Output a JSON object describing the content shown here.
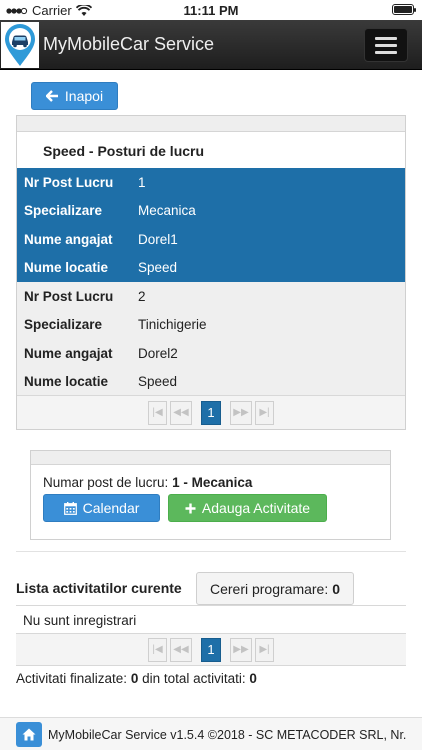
{
  "status_bar": {
    "carrier": "Carrier",
    "time": "11:11 PM"
  },
  "navbar": {
    "title": "MyMobileCar Service"
  },
  "back_button": {
    "label": "Inapoi"
  },
  "posts_panel": {
    "caption": "Speed - Posturi de lucru",
    "labels": {
      "nr": "Nr Post Lucru",
      "spec": "Specializare",
      "angajat": "Nume angajat",
      "locatie": "Nume locatie"
    },
    "records": [
      {
        "nr": "1",
        "spec": "Mecanica",
        "angajat": "Dorel1",
        "locatie": "Speed"
      },
      {
        "nr": "2",
        "spec": "Tinichigerie",
        "angajat": "Dorel2",
        "locatie": "Speed"
      }
    ],
    "current_page": "1"
  },
  "selected_post": {
    "label": "Numar post de lucru:",
    "value": "1 - Mecanica",
    "calendar_label": "Calendar",
    "add_activity_label": "Adauga Activitate"
  },
  "activities": {
    "title": "Lista activitatilor curente",
    "requests_label": "Cereri programare:",
    "requests_count": "0",
    "empty_text": "Nu sunt inregistrari",
    "current_page": "1",
    "finalized_label": "Activitati finalizate:",
    "finalized_count": "0",
    "total_label": "din total activitati:",
    "total_count": "0"
  },
  "footer": {
    "text": "MyMobileCar Service v1.5.4 ©2018  - SC METACODER SRL, Nr."
  },
  "colors": {
    "primary": "#3a8fd7",
    "selected_row": "#1e6fa8",
    "success": "#5cb85c",
    "navbar": "#2a2a2a"
  }
}
